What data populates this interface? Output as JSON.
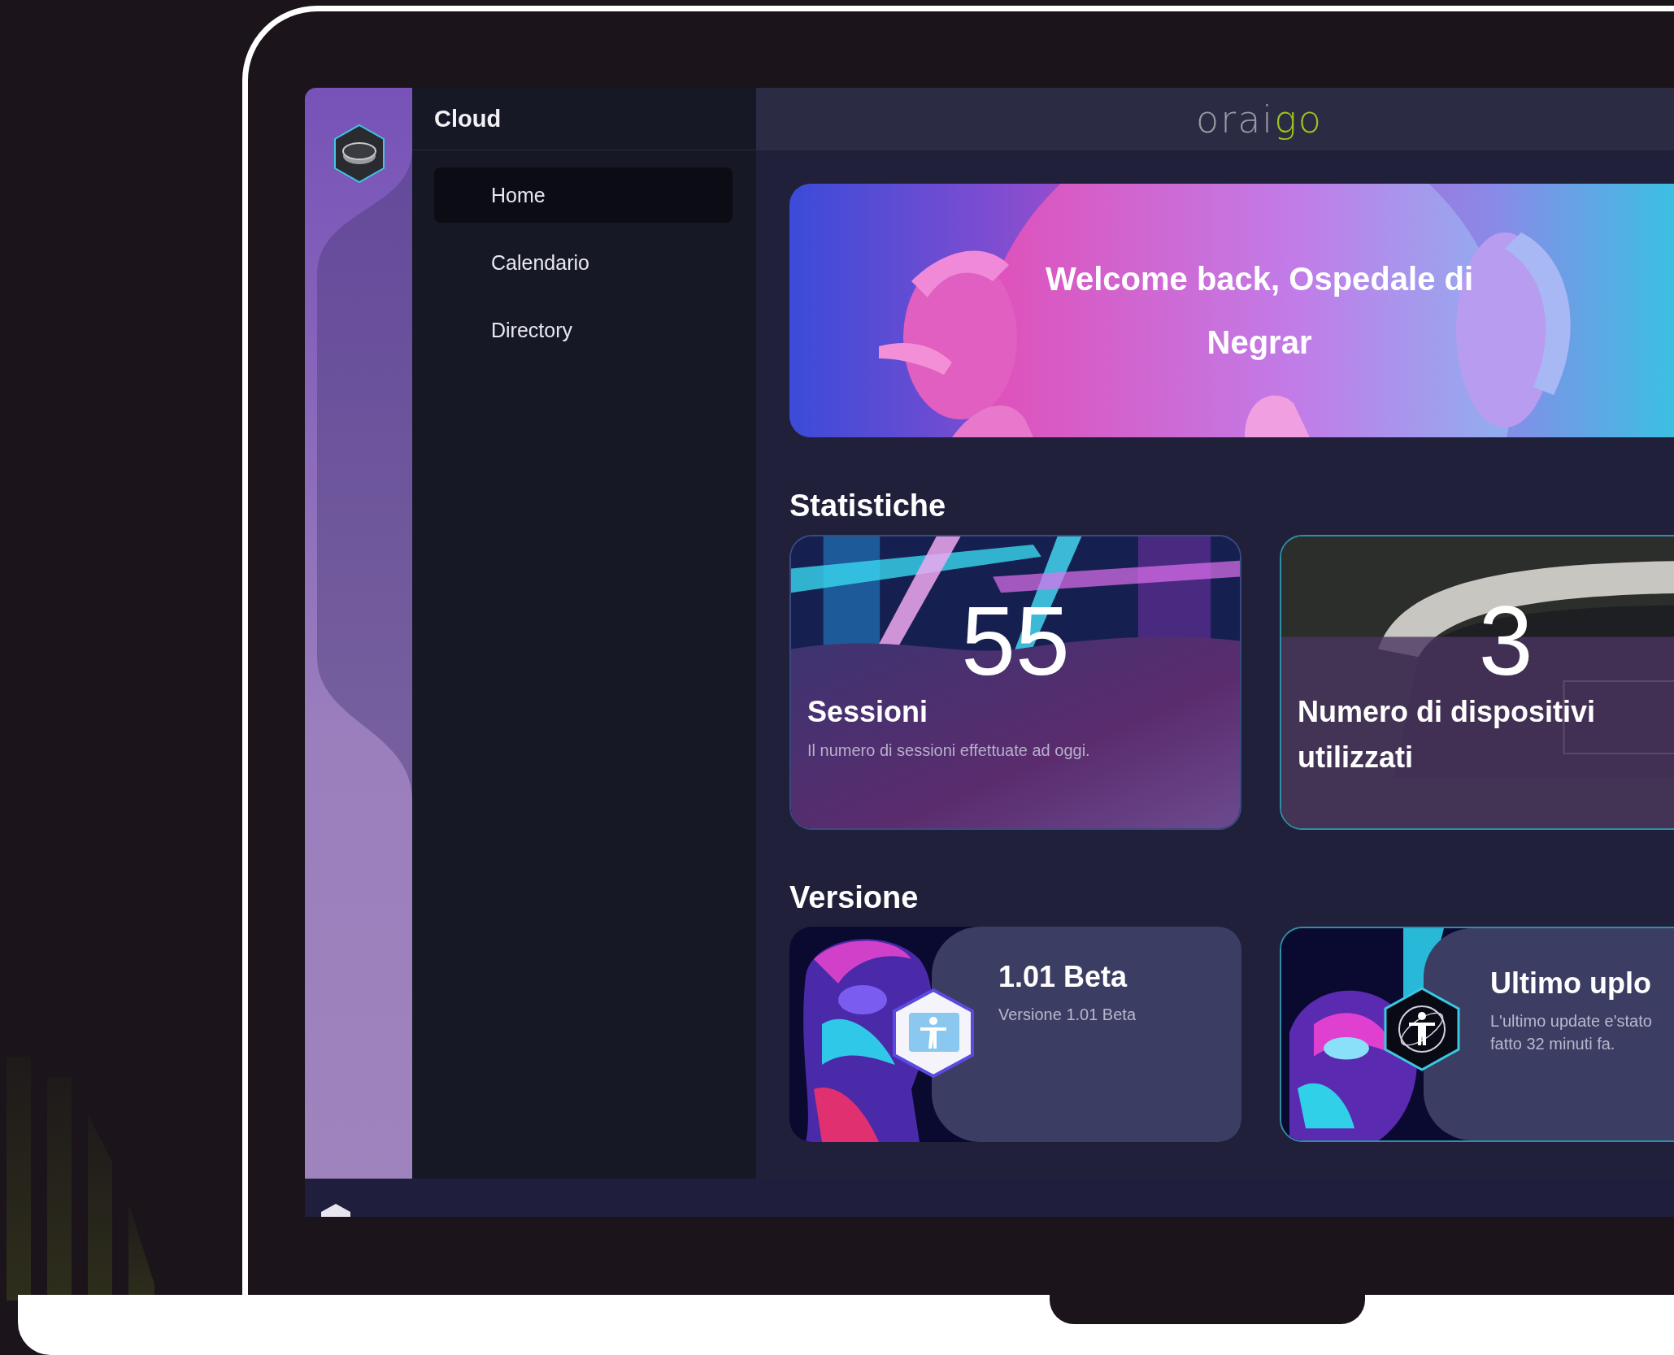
{
  "sidebar": {
    "title": "Cloud",
    "items": [
      {
        "label": "Home",
        "selected": true
      },
      {
        "label": "Calendario",
        "selected": false
      },
      {
        "label": "Directory",
        "selected": false
      }
    ]
  },
  "header": {
    "logo": {
      "text": "orai",
      "accent": "go"
    }
  },
  "banner": {
    "greeting": "Welcome back, Ospedale di Negrar"
  },
  "statistics": {
    "title": "Statistiche",
    "cards": [
      {
        "kind": "sessions",
        "value": "55",
        "label": "Sessioni",
        "description": "Il numero di sessioni effettuate ad oggi."
      },
      {
        "kind": "devices",
        "value": "3",
        "label": "Numero di dispositivi utilizzati"
      }
    ]
  },
  "version": {
    "title": "Versione",
    "cards": [
      {
        "kind": "release",
        "title": "1.01 Beta",
        "description": "Versione 1.01 Beta"
      },
      {
        "kind": "update",
        "title": "Ultimo uplo",
        "description": "L'ultimo update e'stato fatto 32 minuti fa."
      }
    ]
  }
}
